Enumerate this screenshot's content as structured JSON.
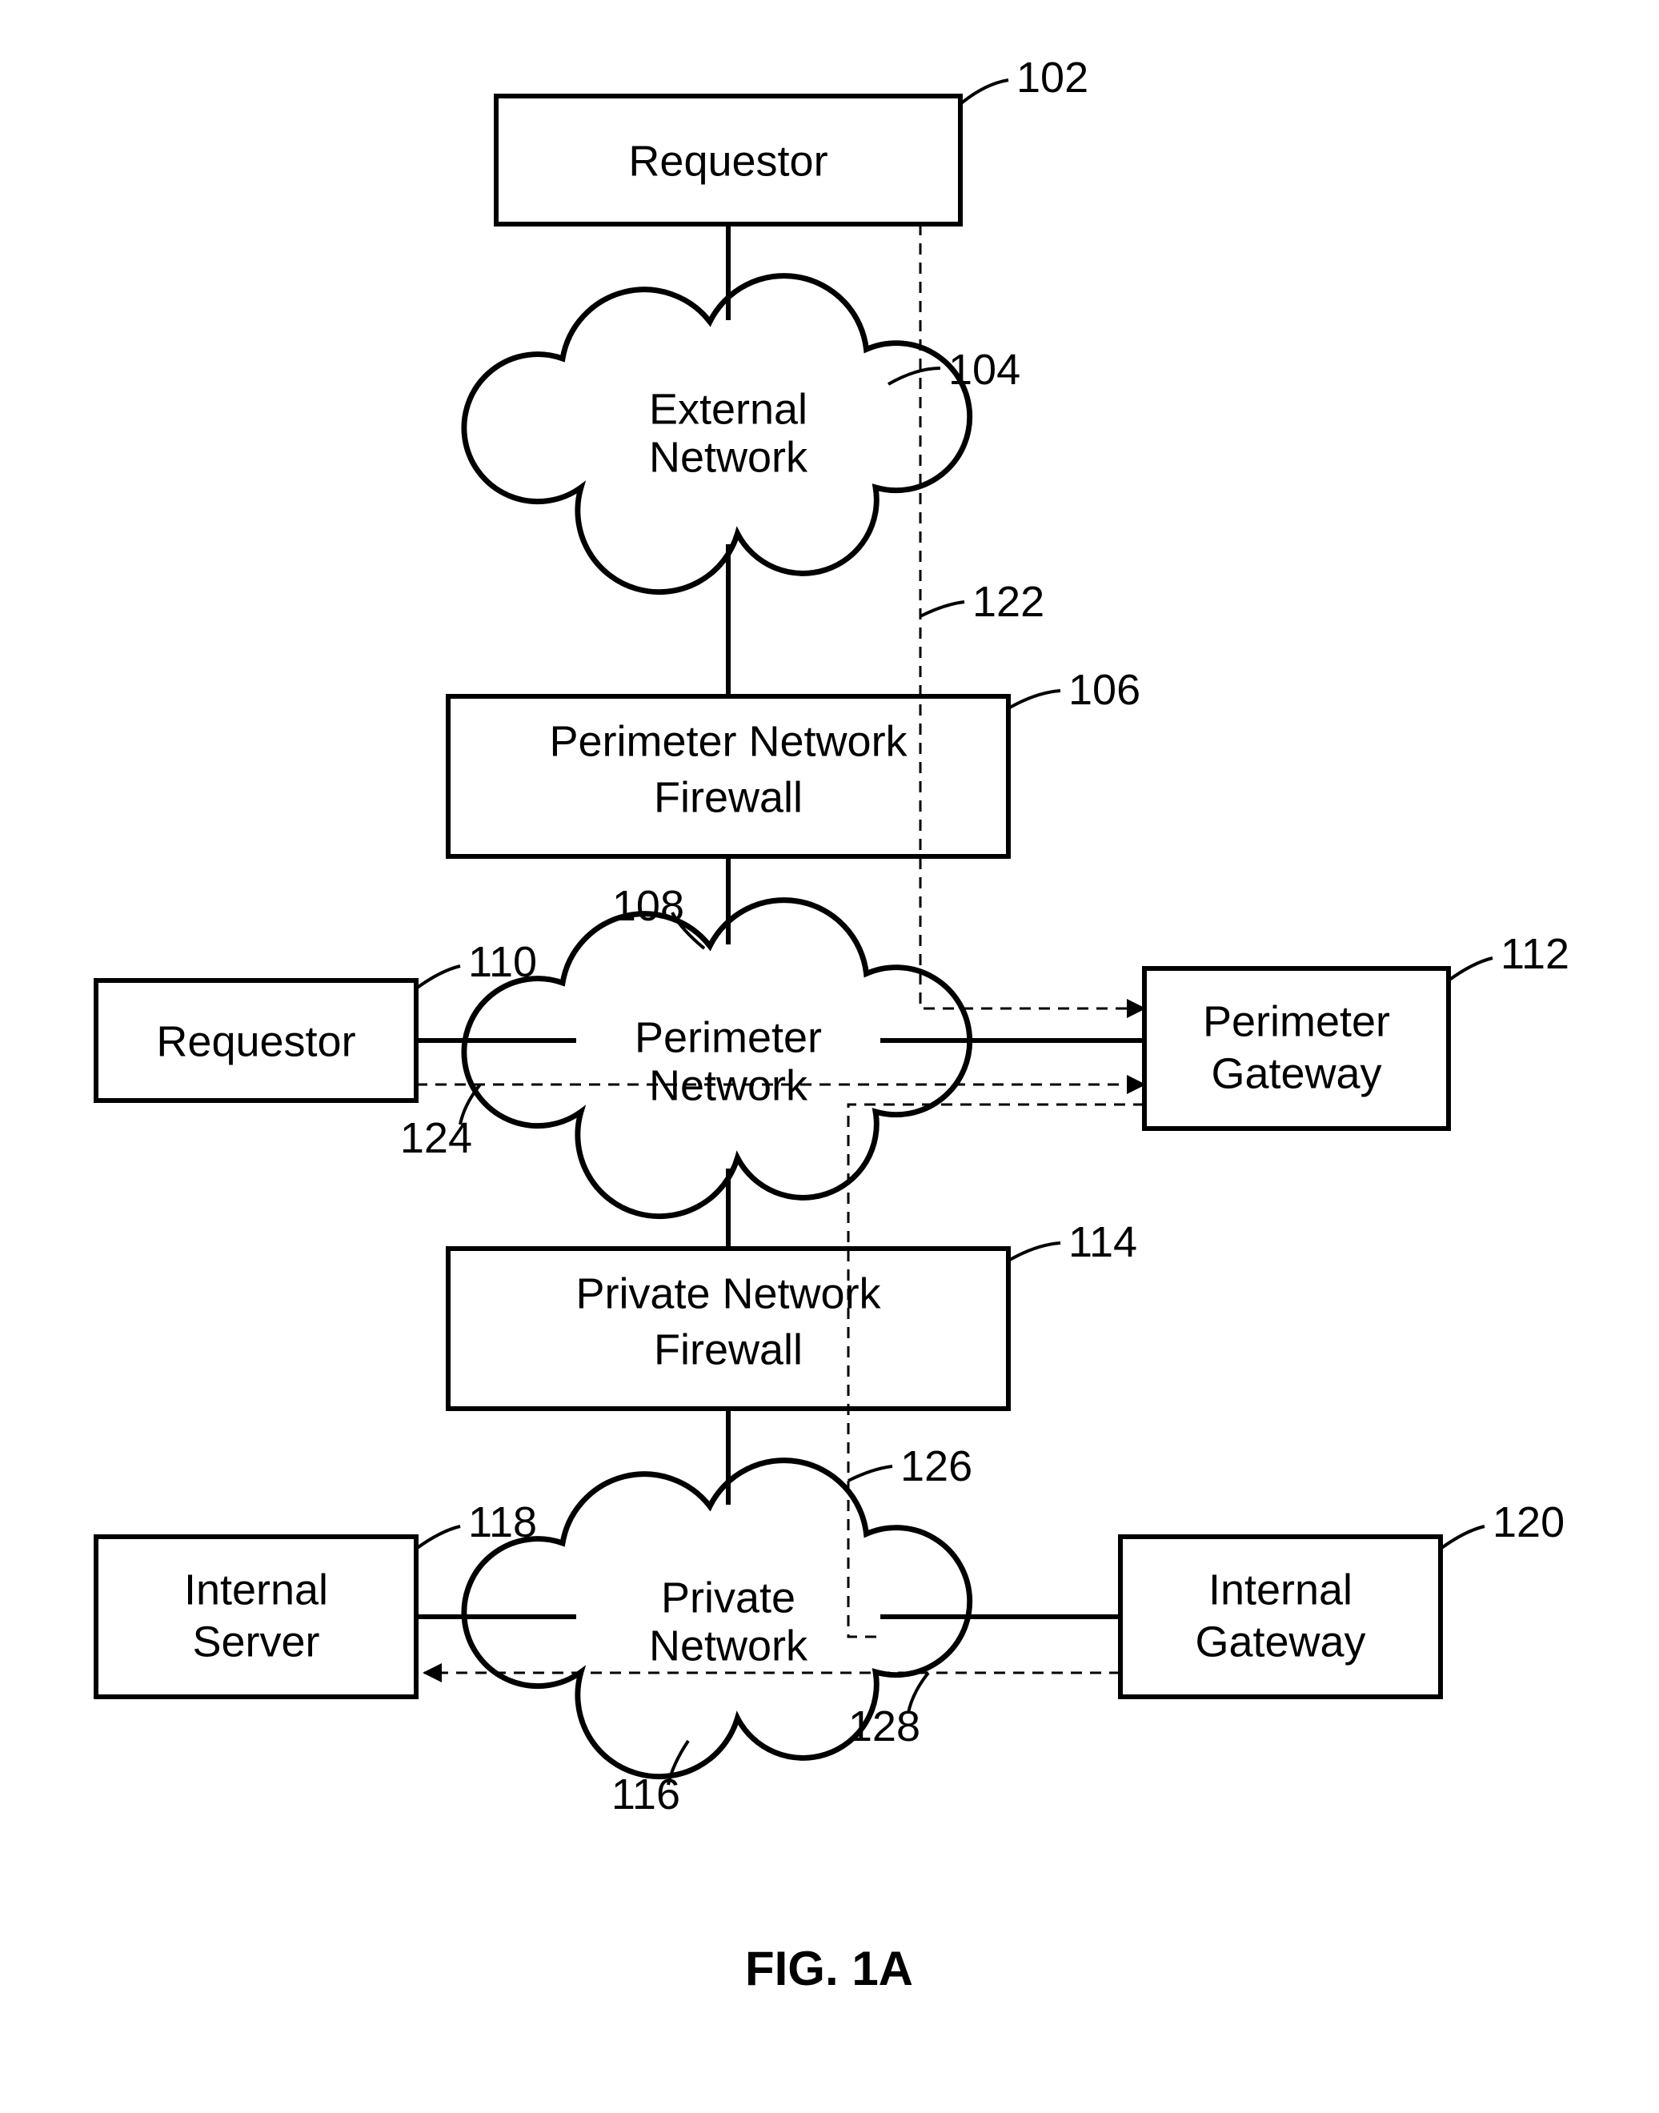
{
  "figure_caption": "FIG. 1A",
  "nodes": {
    "requestor_top": {
      "label": "Requestor",
      "ref": "102"
    },
    "external_network": {
      "label1": "External",
      "label2": "Network",
      "ref": "104"
    },
    "perimeter_firewall": {
      "label1": "Perimeter Network",
      "label2": "Firewall",
      "ref": "106"
    },
    "perimeter_network": {
      "label1": "Perimeter",
      "label2": "Network",
      "ref": "108"
    },
    "requestor_left": {
      "label": "Requestor",
      "ref": "110"
    },
    "perimeter_gateway": {
      "label1": "Perimeter",
      "label2": "Gateway",
      "ref": "112"
    },
    "private_firewall": {
      "label1": "Private Network",
      "label2": "Firewall",
      "ref": "114"
    },
    "private_network": {
      "label1": "Private",
      "label2": "Network",
      "ref": "116"
    },
    "internal_server": {
      "label1": "Internal",
      "label2": "Server",
      "ref": "118"
    },
    "internal_gateway": {
      "label1": "Internal",
      "label2": "Gateway",
      "ref": "120"
    }
  },
  "path_refs": {
    "p122": "122",
    "p124": "124",
    "p126": "126",
    "p128": "128"
  }
}
